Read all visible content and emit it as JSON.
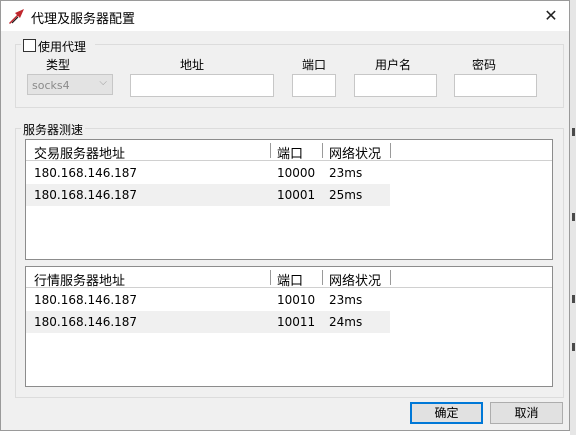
{
  "window": {
    "title": "代理及服务器配置",
    "close_glyph": "✕"
  },
  "proxy": {
    "use_proxy_label": "使用代理",
    "use_proxy_checked": false,
    "type_label": "类型",
    "type_value": "socks4",
    "address_label": "地址",
    "port_label": "端口",
    "username_label": "用户名",
    "password_label": "密码",
    "address_value": "",
    "port_value": "",
    "username_value": "",
    "password_value": ""
  },
  "server_test": {
    "legend": "服务器测速",
    "trade_table": {
      "headers": [
        "交易服务器地址",
        "端口",
        "网络状况"
      ],
      "rows": [
        {
          "address": "180.168.146.187",
          "port": "10000",
          "status": "23ms"
        },
        {
          "address": "180.168.146.187",
          "port": "10001",
          "status": "25ms"
        }
      ]
    },
    "quote_table": {
      "headers": [
        "行情服务器地址",
        "端口",
        "网络状况"
      ],
      "rows": [
        {
          "address": "180.168.146.187",
          "port": "10010",
          "status": "23ms"
        },
        {
          "address": "180.168.146.187",
          "port": "10011",
          "status": "24ms"
        }
      ]
    }
  },
  "buttons": {
    "ok": "确定",
    "cancel": "取消"
  },
  "colors": {
    "accent": "#0078d7",
    "window_bg": "#f0f0f0",
    "icon_red": "#c0272d"
  }
}
